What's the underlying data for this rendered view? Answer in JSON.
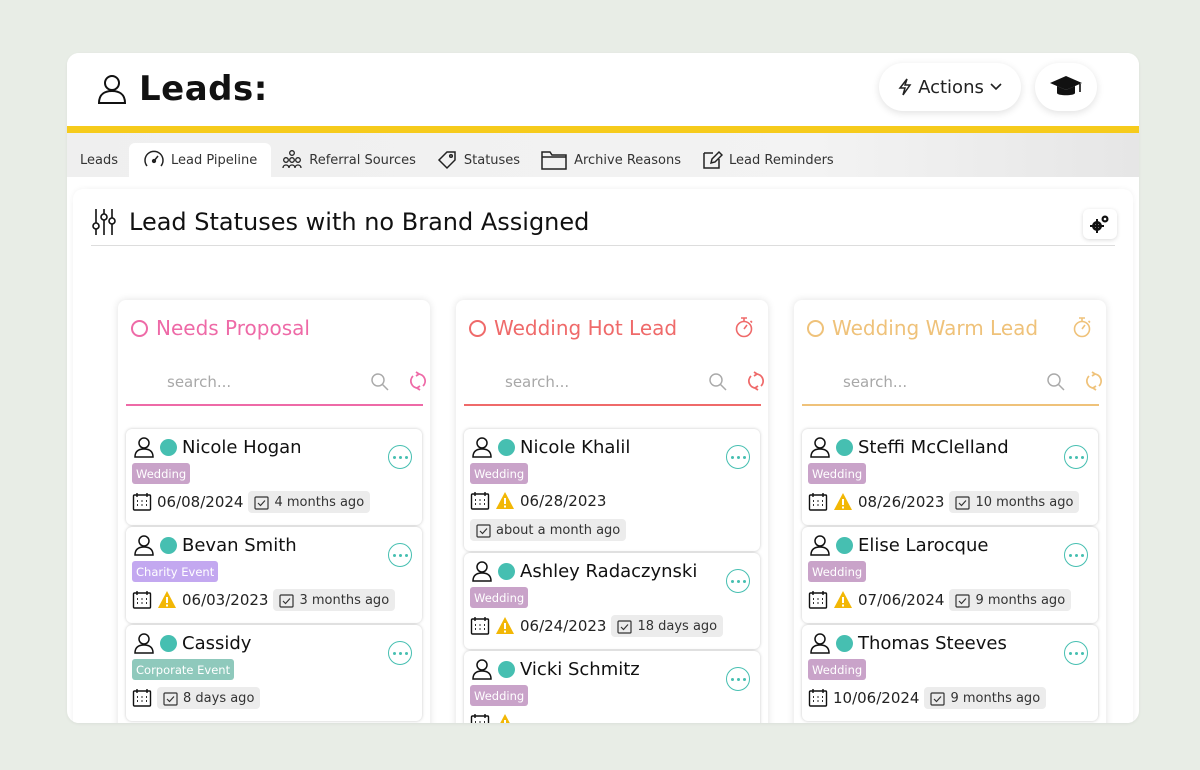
{
  "header": {
    "title": "Leads:",
    "actions_label": "Actions"
  },
  "tabs": {
    "root_label": "Leads",
    "items": [
      {
        "label": "Lead Pipeline",
        "icon": "gauge-icon",
        "active": true
      },
      {
        "label": "Referral Sources",
        "icon": "network-icon",
        "active": false
      },
      {
        "label": "Statuses",
        "icon": "tag-icon",
        "active": false
      },
      {
        "label": "Archive Reasons",
        "icon": "folder-icon",
        "active": false
      },
      {
        "label": "Lead Reminders",
        "icon": "edit-icon",
        "active": false
      }
    ]
  },
  "panel": {
    "title": "Lead Statuses with no Brand Assigned"
  },
  "colors": {
    "accent_yellow": "#f6cb1c",
    "status_dot": "#46bfb1",
    "tag_wedding": "#c9a3c9",
    "tag_charity": "#c3a8f0",
    "tag_corporate": "#8fc9bc",
    "warning": "#f2b705"
  },
  "columns": [
    {
      "title": "Needs Proposal",
      "color": "#ee6aa7",
      "has_timer": false,
      "search_placeholder": "search...",
      "cards": [
        {
          "name": "Nicole Hogan",
          "tag": "Wedding",
          "tag_color": "#c9a3c9",
          "warning": false,
          "date": "06/08/2024",
          "ago": "4 months ago"
        },
        {
          "name": "Bevan Smith",
          "tag": "Charity Event",
          "tag_color": "#c3a8f0",
          "warning": true,
          "date": "06/03/2023",
          "ago": "3 months ago"
        },
        {
          "name": "Cassidy",
          "tag": "Corporate Event",
          "tag_color": "#8fc9bc",
          "warning": false,
          "date": "",
          "ago": "8 days ago"
        }
      ]
    },
    {
      "title": "Wedding Hot Lead",
      "color": "#ef6a6a",
      "has_timer": true,
      "search_placeholder": "search...",
      "cards": [
        {
          "name": "Nicole Khalil",
          "tag": "Wedding",
          "tag_color": "#c9a3c9",
          "warning": true,
          "date": "06/28/2023",
          "ago": "about a month ago"
        },
        {
          "name": "Ashley Radaczynski",
          "tag": "Wedding",
          "tag_color": "#c9a3c9",
          "warning": true,
          "date": "06/24/2023",
          "ago": "18 days ago"
        },
        {
          "name": "Vicki Schmitz",
          "tag": "Wedding",
          "tag_color": "#c9a3c9",
          "warning": true,
          "date": "",
          "ago": ""
        }
      ]
    },
    {
      "title": "Wedding Warm Lead",
      "color": "#efc27a",
      "has_timer": true,
      "search_placeholder": "search...",
      "cards": [
        {
          "name": "Steffi McClelland",
          "tag": "Wedding",
          "tag_color": "#c9a3c9",
          "warning": true,
          "date": "08/26/2023",
          "ago": "10 months ago"
        },
        {
          "name": "Elise Larocque",
          "tag": "Wedding",
          "tag_color": "#c9a3c9",
          "warning": true,
          "date": "07/06/2024",
          "ago": "9 months ago"
        },
        {
          "name": "Thomas Steeves",
          "tag": "Wedding",
          "tag_color": "#c9a3c9",
          "warning": false,
          "date": "10/06/2024",
          "ago": "9 months ago"
        }
      ]
    }
  ]
}
